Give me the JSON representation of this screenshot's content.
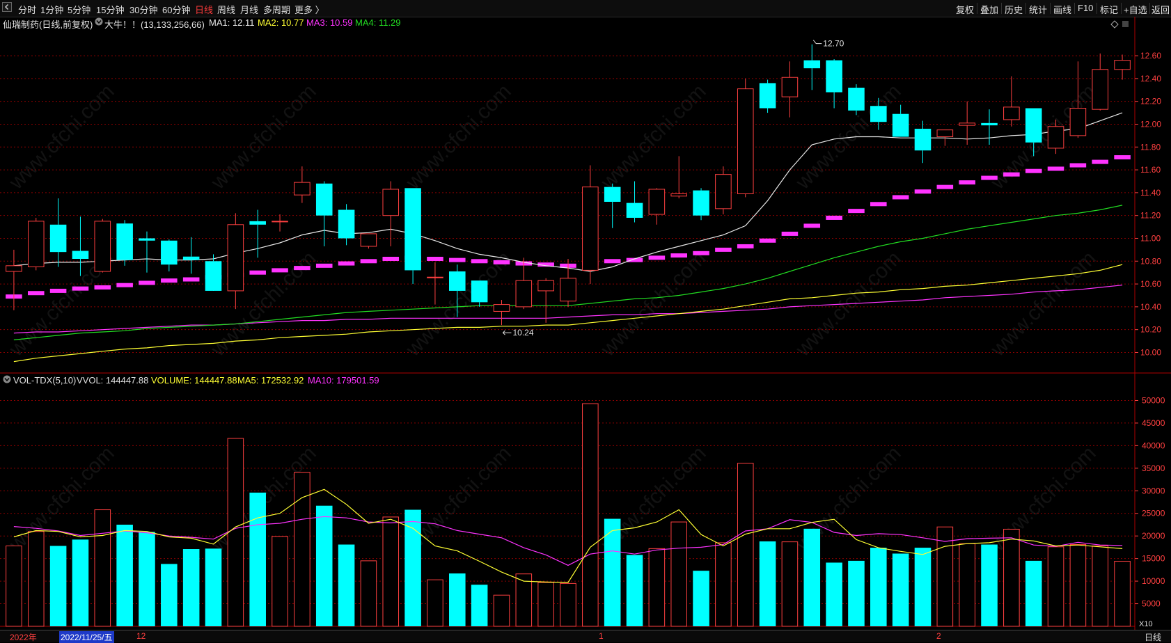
{
  "toolbar": {
    "back_icon": "chevron-left-icon",
    "periods": [
      "分时",
      "1分钟",
      "5分钟",
      "15分钟",
      "30分钟",
      "60分钟",
      "日线",
      "周线",
      "月线",
      "多周期",
      "更多 〉"
    ],
    "active_period": "日线",
    "right_items": [
      "复权",
      "叠加",
      "历史",
      "统计",
      "画线",
      "F10",
      "标记",
      "+自选",
      "返回"
    ]
  },
  "info": {
    "stock_title": "仙瑞制药(日线,前复权)",
    "tag": "大牛！！(13,133,256,66)",
    "ma1": "MA1: 12.11",
    "ma2": "MA2: 10.77",
    "ma3": "MA3: 10.59",
    "ma4": "MA4: 11.29",
    "corner_icon": "diamond-icon"
  },
  "vol_info": {
    "indicator": "VOL-TDX(5,10)",
    "vvol": "VVOL: 144447.88",
    "volume": "VOLUME: 144447.88",
    "ma5": "MA5: 172532.92",
    "ma10": "MA10: 179501.59"
  },
  "colors": {
    "up": "#ff4040",
    "down": "#00ffff",
    "ma1": "#e8e8e8",
    "ma2": "#ffff33",
    "ma3": "#ff33ff",
    "ma4": "#22dd22",
    "grid": "#8b0000",
    "axis_text": "#ff4040"
  },
  "bottom": {
    "year": "2022年",
    "cursor_date": "2022/11/25/五",
    "month_dec": "12",
    "month_jan": "1",
    "month_feb": "2",
    "period_label": "日线",
    "scale_label": "X10"
  },
  "chart_data": [
    {
      "type": "candlestick",
      "y_ticks": [
        "12.60",
        "12.40",
        "12.20",
        "12.00",
        "11.80",
        "11.60",
        "11.40",
        "11.20",
        "11.00",
        "10.80",
        "10.60",
        "10.40",
        "10.20",
        "10.00"
      ],
      "ylim": [
        9.82,
        12.82
      ],
      "annotations": {
        "high": "12.70",
        "low": "10.24"
      },
      "candles": [
        {
          "o": 10.71,
          "h": 10.9,
          "l": 10.37,
          "c": 10.76
        },
        {
          "o": 10.75,
          "h": 11.18,
          "l": 10.72,
          "c": 11.15
        },
        {
          "o": 11.12,
          "h": 11.35,
          "l": 10.75,
          "c": 10.88
        },
        {
          "o": 10.89,
          "h": 11.19,
          "l": 10.67,
          "c": 10.82
        },
        {
          "o": 10.71,
          "h": 11.17,
          "l": 10.7,
          "c": 11.15
        },
        {
          "o": 11.13,
          "h": 11.16,
          "l": 10.76,
          "c": 10.81
        },
        {
          "o": 11.0,
          "h": 11.06,
          "l": 10.7,
          "c": 10.98
        },
        {
          "o": 10.98,
          "h": 10.99,
          "l": 10.71,
          "c": 10.77
        },
        {
          "o": 10.84,
          "h": 11.01,
          "l": 10.69,
          "c": 10.81
        },
        {
          "o": 10.8,
          "h": 10.86,
          "l": 10.55,
          "c": 10.54
        },
        {
          "o": 10.54,
          "h": 11.22,
          "l": 10.38,
          "c": 11.12
        },
        {
          "o": 11.15,
          "h": 11.25,
          "l": 10.83,
          "c": 11.12
        },
        {
          "o": 11.15,
          "h": 11.21,
          "l": 11.06,
          "c": 11.15
        },
        {
          "o": 11.38,
          "h": 11.63,
          "l": 11.31,
          "c": 11.49
        },
        {
          "o": 11.48,
          "h": 11.5,
          "l": 10.93,
          "c": 11.2
        },
        {
          "o": 11.25,
          "h": 11.3,
          "l": 10.94,
          "c": 11.0
        },
        {
          "o": 10.93,
          "h": 11.04,
          "l": 10.91,
          "c": 11.04
        },
        {
          "o": 11.2,
          "h": 11.5,
          "l": 10.93,
          "c": 11.43
        },
        {
          "o": 11.44,
          "h": 11.44,
          "l": 10.6,
          "c": 10.72
        },
        {
          "o": 10.66,
          "h": 10.79,
          "l": 10.42,
          "c": 10.66
        },
        {
          "o": 10.71,
          "h": 10.77,
          "l": 10.31,
          "c": 10.54
        },
        {
          "o": 10.63,
          "h": 10.63,
          "l": 10.4,
          "c": 10.44
        },
        {
          "o": 10.36,
          "h": 10.46,
          "l": 10.24,
          "c": 10.42
        },
        {
          "o": 10.4,
          "h": 10.83,
          "l": 10.38,
          "c": 10.63
        },
        {
          "o": 10.54,
          "h": 10.65,
          "l": 10.26,
          "c": 10.63
        },
        {
          "o": 10.45,
          "h": 10.82,
          "l": 10.4,
          "c": 10.65
        },
        {
          "o": 10.72,
          "h": 11.64,
          "l": 10.6,
          "c": 11.45
        },
        {
          "o": 11.45,
          "h": 11.48,
          "l": 11.09,
          "c": 11.32
        },
        {
          "o": 11.31,
          "h": 11.5,
          "l": 11.14,
          "c": 11.18
        },
        {
          "o": 11.21,
          "h": 11.44,
          "l": 11.12,
          "c": 11.43
        },
        {
          "o": 11.37,
          "h": 11.72,
          "l": 11.35,
          "c": 11.39
        },
        {
          "o": 11.42,
          "h": 11.44,
          "l": 11.16,
          "c": 11.2
        },
        {
          "o": 11.26,
          "h": 11.63,
          "l": 11.21,
          "c": 11.56
        },
        {
          "o": 11.39,
          "h": 12.4,
          "l": 11.36,
          "c": 12.31
        },
        {
          "o": 12.36,
          "h": 12.39,
          "l": 12.1,
          "c": 12.14
        },
        {
          "o": 12.24,
          "h": 12.55,
          "l": 12.06,
          "c": 12.41
        },
        {
          "o": 12.56,
          "h": 12.7,
          "l": 12.3,
          "c": 12.49
        },
        {
          "o": 12.56,
          "h": 12.57,
          "l": 12.14,
          "c": 12.28
        },
        {
          "o": 12.32,
          "h": 12.35,
          "l": 12.08,
          "c": 12.12
        },
        {
          "o": 12.16,
          "h": 12.23,
          "l": 11.95,
          "c": 12.02
        },
        {
          "o": 12.09,
          "h": 12.17,
          "l": 11.91,
          "c": 11.89
        },
        {
          "o": 11.96,
          "h": 12.03,
          "l": 11.66,
          "c": 11.77
        },
        {
          "o": 11.89,
          "h": 11.95,
          "l": 11.81,
          "c": 11.95
        },
        {
          "o": 11.99,
          "h": 12.2,
          "l": 11.82,
          "c": 12.01
        },
        {
          "o": 12.01,
          "h": 12.13,
          "l": 11.82,
          "c": 11.99
        },
        {
          "o": 12.04,
          "h": 12.42,
          "l": 11.98,
          "c": 12.15
        },
        {
          "o": 12.14,
          "h": 12.14,
          "l": 11.72,
          "c": 11.84
        },
        {
          "o": 11.79,
          "h": 12.04,
          "l": 11.74,
          "c": 11.98
        },
        {
          "o": 11.9,
          "h": 12.55,
          "l": 11.88,
          "c": 12.14
        },
        {
          "o": 12.13,
          "h": 12.62,
          "l": 12.12,
          "c": 12.48
        },
        {
          "o": 12.48,
          "h": 12.61,
          "l": 12.39,
          "c": 12.56
        }
      ],
      "ma1": [
        10.76,
        10.78,
        10.79,
        10.79,
        10.8,
        10.81,
        10.82,
        10.81,
        10.81,
        10.82,
        10.87,
        10.91,
        10.96,
        11.03,
        11.07,
        11.04,
        11.05,
        11.08,
        11.04,
        10.98,
        10.91,
        10.86,
        10.83,
        10.79,
        10.76,
        10.74,
        10.71,
        10.75,
        10.82,
        10.88,
        10.93,
        10.98,
        11.03,
        11.11,
        11.33,
        11.6,
        11.82,
        11.87,
        11.89,
        11.89,
        11.88,
        11.88,
        11.88,
        11.87,
        11.88,
        11.9,
        11.91,
        11.94,
        11.96,
        12.03,
        12.1
      ],
      "ma2": [
        9.92,
        9.95,
        9.97,
        9.99,
        10.01,
        10.03,
        10.04,
        10.06,
        10.07,
        10.08,
        10.1,
        10.11,
        10.13,
        10.14,
        10.15,
        10.16,
        10.18,
        10.19,
        10.2,
        10.21,
        10.22,
        10.22,
        10.23,
        10.23,
        10.24,
        10.24,
        10.26,
        10.28,
        10.3,
        10.32,
        10.34,
        10.36,
        10.38,
        10.41,
        10.44,
        10.47,
        10.48,
        10.5,
        10.52,
        10.53,
        10.55,
        10.56,
        10.58,
        10.59,
        10.61,
        10.63,
        10.65,
        10.67,
        10.69,
        10.72,
        10.77
      ],
      "ma3": [
        10.17,
        10.18,
        10.18,
        10.19,
        10.2,
        10.21,
        10.22,
        10.23,
        10.24,
        10.24,
        10.25,
        10.26,
        10.27,
        10.28,
        10.28,
        10.29,
        10.29,
        10.3,
        10.3,
        10.3,
        10.3,
        10.3,
        10.3,
        10.3,
        10.3,
        10.31,
        10.32,
        10.33,
        10.33,
        10.34,
        10.34,
        10.35,
        10.36,
        10.37,
        10.38,
        10.4,
        10.41,
        10.42,
        10.43,
        10.44,
        10.45,
        10.46,
        10.48,
        10.49,
        10.5,
        10.51,
        10.53,
        10.54,
        10.55,
        10.57,
        10.59
      ],
      "ma4": [
        10.11,
        10.13,
        10.15,
        10.17,
        10.18,
        10.19,
        10.21,
        10.22,
        10.23,
        10.24,
        10.25,
        10.27,
        10.29,
        10.31,
        10.33,
        10.35,
        10.36,
        10.37,
        10.38,
        10.39,
        10.4,
        10.41,
        10.41,
        10.41,
        10.41,
        10.41,
        10.43,
        10.45,
        10.47,
        10.48,
        10.5,
        10.53,
        10.56,
        10.6,
        10.65,
        10.71,
        10.77,
        10.83,
        10.88,
        10.93,
        10.97,
        11.0,
        11.04,
        11.08,
        11.11,
        11.14,
        11.17,
        11.2,
        11.22,
        11.25,
        11.29
      ],
      "support": [
        10.49,
        10.52,
        10.54,
        10.56,
        10.57,
        10.59,
        10.61,
        10.63,
        10.64,
        10.66,
        10.68,
        10.7,
        10.72,
        10.74,
        10.76,
        10.78,
        10.8,
        10.82,
        10.83,
        10.82,
        10.81,
        10.8,
        10.79,
        10.78,
        10.77,
        10.76,
        10.78,
        10.8,
        10.81,
        10.83,
        10.85,
        10.87,
        10.9,
        10.93,
        10.98,
        11.04,
        11.11,
        11.18,
        11.24,
        11.3,
        11.36,
        11.41,
        11.45,
        11.49,
        11.53,
        11.56,
        11.59,
        11.61,
        11.64,
        11.67,
        11.71
      ]
    },
    {
      "type": "bar",
      "y_ticks": [
        "50000",
        "45000",
        "40000",
        "35000",
        "30000",
        "25000",
        "20000",
        "15000",
        "10000",
        "5000"
      ],
      "ylim": [
        0,
        53000
      ],
      "volume": [
        17800,
        21000,
        17800,
        19200,
        25800,
        22500,
        20900,
        13800,
        17100,
        17200,
        41600,
        29600,
        19900,
        34100,
        26700,
        18100,
        14500,
        24200,
        25800,
        10300,
        11700,
        9200,
        6900,
        11600,
        9700,
        9500,
        49300,
        23800,
        15800,
        17200,
        23100,
        12300,
        18500,
        36100,
        18800,
        18700,
        21600,
        14100,
        14500,
        17400,
        16100,
        17400,
        22000,
        18300,
        18100,
        21500,
        14500,
        17600,
        18100,
        17800,
        14400
      ],
      "ma5": [
        19800,
        21200,
        21000,
        19800,
        20100,
        21200,
        21000,
        19800,
        19500,
        18200,
        22000,
        24000,
        25000,
        28500,
        30300,
        27000,
        22800,
        23700,
        21700,
        17800,
        16700,
        14400,
        12000,
        10000,
        9800,
        9700,
        17500,
        21200,
        21800,
        23100,
        25800,
        20300,
        17800,
        20400,
        21600,
        21600,
        23000,
        23700,
        19200,
        17400,
        16600,
        15900,
        17700,
        18300,
        18500,
        19300,
        18900,
        17800,
        18000,
        17600,
        17200
      ],
      "ma10": [
        22100,
        21700,
        21100,
        20100,
        20600,
        21100,
        20700,
        20000,
        19700,
        19300,
        21700,
        22500,
        22800,
        23700,
        24300,
        24000,
        23100,
        22900,
        23200,
        22700,
        21200,
        20400,
        19600,
        17400,
        15800,
        13500,
        16000,
        16700,
        16000,
        16900,
        17300,
        17500,
        18100,
        21100,
        21600,
        23600,
        23000,
        20800,
        20100,
        20500,
        20300,
        19600,
        18800,
        19400,
        19500,
        19600,
        18000,
        17700,
        18600,
        18000,
        17900
      ]
    }
  ]
}
